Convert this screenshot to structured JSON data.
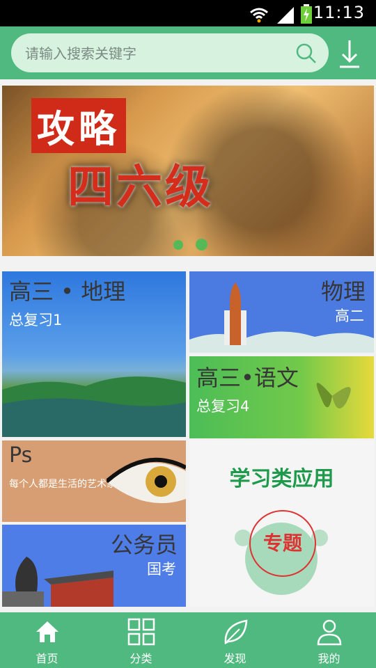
{
  "status_bar": {
    "time": "11:13"
  },
  "search": {
    "placeholder": "请输入搜索关键字"
  },
  "banner": {
    "text_top": "攻略",
    "text_bottom": "四六级"
  },
  "tiles": {
    "geography": {
      "title": "高三 • 地理",
      "subtitle": "总复习1"
    },
    "physics": {
      "title": "物理",
      "subtitle": "高二"
    },
    "chinese": {
      "title": "高三•语文",
      "subtitle": "总复习4"
    },
    "ps": {
      "title": "Ps",
      "subtitle": "每个人都是生活的艺术家"
    },
    "civil": {
      "title": "公务员",
      "subtitle": "国考"
    },
    "topic": {
      "title": "学习类应用",
      "badge": "专题"
    }
  },
  "bottom_nav": [
    {
      "label": "首页",
      "icon": "home-icon"
    },
    {
      "label": "分类",
      "icon": "grid-icon"
    },
    {
      "label": "发现",
      "icon": "leaf-icon"
    },
    {
      "label": "我的",
      "icon": "user-icon"
    }
  ]
}
